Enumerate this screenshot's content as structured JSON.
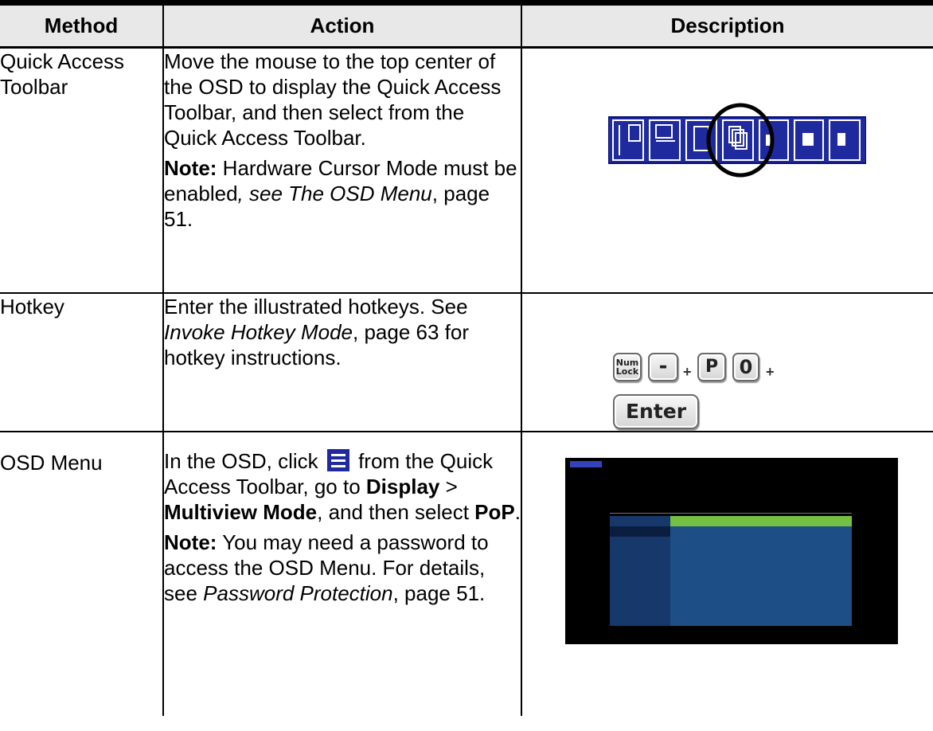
{
  "table": {
    "headers": {
      "method": "Method",
      "action": "Action",
      "description": "Description"
    },
    "rows": [
      {
        "method": "Quick Access Toolbar",
        "action": {
          "text": "Move the mouse to the top center of the OSD to display the Quick Access Toolbar, and then select from the Quick Access Toolbar.",
          "note_label": "Note:",
          "note_text_1": " Hardware Cursor Mode must be enabled",
          "note_text_2": ", see ",
          "note_ref": "The OSD Menu",
          "note_text_3": ", page 51."
        }
      },
      {
        "method": "Hotkey",
        "action": {
          "text_1": "Enter the illustrated hotkeys. See ",
          "ref": "Invoke Hotkey Mode",
          "text_2": ", page 63 for hotkey instructions."
        },
        "keys": {
          "numlock_1": "Num",
          "numlock_2": "Lock",
          "minus": "-",
          "plus": "+",
          "p": "P",
          "zero": "0",
          "enter": "Enter"
        }
      },
      {
        "method": "OSD Menu",
        "action": {
          "text_1": "In the OSD, click ",
          "text_2": " from the Quick Access Toolbar, go to ",
          "display": "Display",
          "sep": " > ",
          "multiview": "Multiview Mode",
          "text_3": ", and then select ",
          "pop": "PoP",
          "text_4": ".",
          "note_label": "Note:",
          "note_text_1": " You may need a password to access the OSD Menu. For details, see ",
          "note_ref": "Password Protection",
          "note_text_2": ", page 51."
        },
        "icon": "menu-icon"
      }
    ]
  },
  "colors": {
    "toolbar_blue": "#1f2a9e",
    "osd_side": "#16386b",
    "osd_main": "#1d4f86",
    "osd_selected": "#74c043"
  }
}
